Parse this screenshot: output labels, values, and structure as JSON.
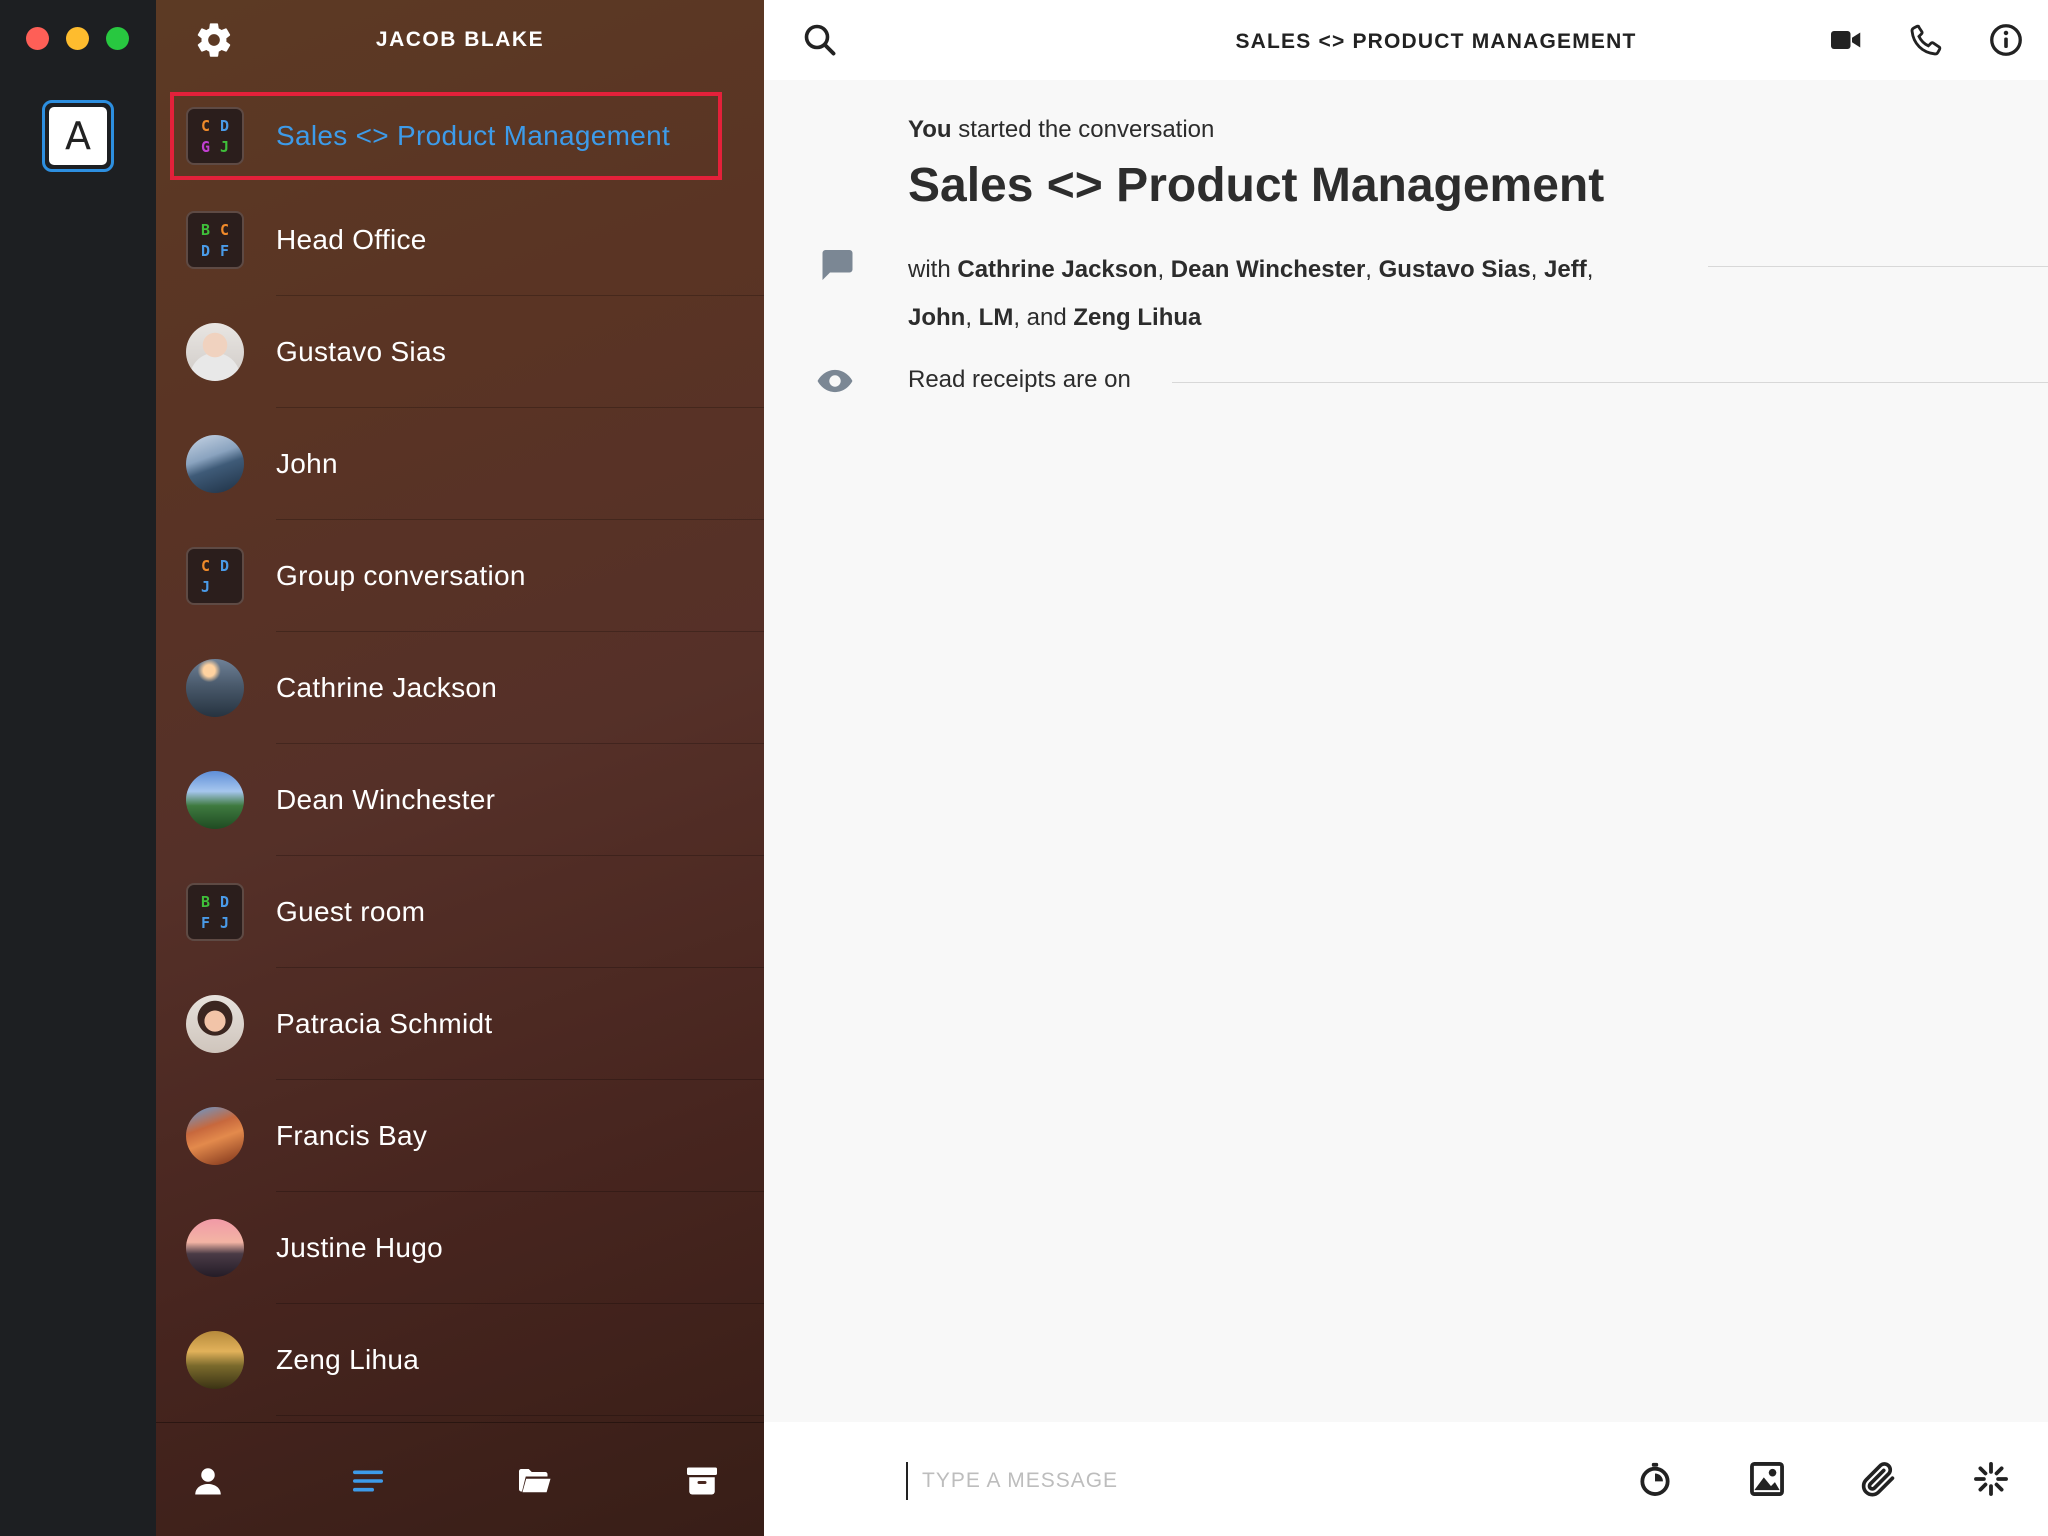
{
  "window": {
    "traffic_lights": [
      "close",
      "minimize",
      "zoom"
    ]
  },
  "account": {
    "letter": "A"
  },
  "sidebar": {
    "user_name": "JACOB BLAKE",
    "conversations": [
      {
        "name": "Sales <> Product Management",
        "type": "group",
        "letters": [
          [
            "C",
            "#f08a2a"
          ],
          [
            "D",
            "#4a9be8"
          ],
          [
            "G",
            "#c13fd0"
          ],
          [
            "J",
            "#3fbf3a"
          ]
        ],
        "selected": true
      },
      {
        "name": "Head Office",
        "type": "group",
        "letters": [
          [
            "B",
            "#3fbf3a"
          ],
          [
            "C",
            "#f08a2a"
          ],
          [
            "D",
            "#4a9be8"
          ],
          [
            "F",
            "#4a9be8"
          ]
        ]
      },
      {
        "name": "Gustavo Sias",
        "type": "person",
        "avatar": "portrait-man"
      },
      {
        "name": "John",
        "type": "person",
        "avatar": "mountain-blue"
      },
      {
        "name": "Group conversation",
        "type": "group",
        "letters": [
          [
            "C",
            "#f08a2a"
          ],
          [
            "D",
            "#4a9be8"
          ],
          [
            "J",
            "#4a9be8"
          ],
          [
            "",
            ""
          ]
        ]
      },
      {
        "name": "Cathrine Jackson",
        "type": "person",
        "avatar": "forest-dusk"
      },
      {
        "name": "Dean Winchester",
        "type": "person",
        "avatar": "green-valley"
      },
      {
        "name": "Guest room",
        "type": "group",
        "letters": [
          [
            "B",
            "#3fbf3a"
          ],
          [
            "D",
            "#4a9be8"
          ],
          [
            "F",
            "#4a9be8"
          ],
          [
            "J",
            "#4a9be8"
          ]
        ]
      },
      {
        "name": "Patracia Schmidt",
        "type": "person",
        "avatar": "portrait-woman"
      },
      {
        "name": "Francis Bay",
        "type": "person",
        "avatar": "canyon"
      },
      {
        "name": "Justine Hugo",
        "type": "person",
        "avatar": "pink-peak"
      },
      {
        "name": "Zeng Lihua",
        "type": "person",
        "avatar": "sunset-field"
      }
    ],
    "footer": [
      "contacts-icon",
      "conversations-icon",
      "folder-icon",
      "archive-icon"
    ]
  },
  "main": {
    "title": "SALES <> PRODUCT MANAGEMENT",
    "started_by": "You",
    "started_text": " started the conversation",
    "conversation_title": "Sales <> Product Management",
    "with_prefix": "with ",
    "participants_line1": [
      {
        "name": "Cathrine Jackson",
        "sep": ", "
      },
      {
        "name": "Dean Winchester",
        "sep": ", "
      },
      {
        "name": "Gustavo Sias",
        "sep": ", "
      },
      {
        "name": "Jeff",
        "sep": ","
      }
    ],
    "participants_line2": [
      {
        "name": "John",
        "sep": ", "
      },
      {
        "name": "LM",
        "sep": ", and "
      },
      {
        "name": "Zeng Lihua",
        "sep": ""
      }
    ],
    "receipts_text": "Read receipts are on",
    "composer_placeholder": "TYPE A MESSAGE"
  },
  "colors": {
    "accent": "#3d9be9",
    "selection_outline": "#e3213a"
  }
}
